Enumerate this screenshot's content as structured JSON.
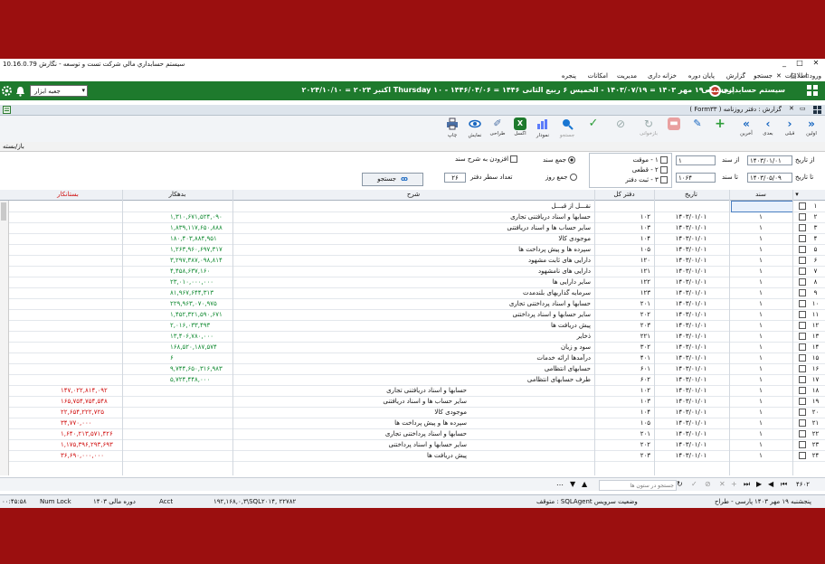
{
  "window": {
    "title": "سیستم حسابداري مالي شرکت تست و توسعه - نگارش 10.16.0.79",
    "minimize": "_",
    "maximize": "□",
    "close": "✕"
  },
  "menu": {
    "items": [
      "ورود اطلاعات",
      "جستجو",
      "گزارش",
      "پایان دوره",
      "خزانه داری",
      "مدیریت",
      "امکانات",
      "پنجره"
    ],
    "window_controls": [
      "✕",
      "□",
      "▫"
    ]
  },
  "header": {
    "system_name": "سیستم حسابداری مالی",
    "date_line": "پنجشنبه ۱۹ مهر ۱۴۰۳ = ۱۴۰۳/۰۷/۱۹ - الخمیس ۶ ربیع الثانی ۱۴۴۶ = ۱۴۴۶/۰۴/۰۶ - Thursday ۱۰ اکتبر ۲۰۲۴ = ۲۰۲۴/۱۰/۱۰",
    "toolbox_label": "جعبه ابزار"
  },
  "form": {
    "caption": "گزارش : دفتر روزنامه ( Form۳۳ )"
  },
  "toolbar": {
    "buttons": [
      {
        "label": "اولین",
        "name": "first-button"
      },
      {
        "label": "قبلی",
        "name": "prev-button"
      },
      {
        "label": "بعدی",
        "name": "next-button"
      },
      {
        "label": "آخرین",
        "name": "last-button"
      },
      {
        "label": "",
        "name": "add-button"
      },
      {
        "label": "",
        "name": "edit-button"
      },
      {
        "label": "",
        "name": "delete-button"
      },
      {
        "label": "بازخوانی",
        "name": "refresh-button"
      },
      {
        "label": "",
        "name": "cancel-button"
      },
      {
        "label": "",
        "name": "confirm-button"
      },
      {
        "label": "جستجو",
        "name": "search-button"
      },
      {
        "label": "نمودار",
        "name": "chart-button"
      },
      {
        "label": "اکسل",
        "name": "excel-button"
      },
      {
        "label": "طراحی",
        "name": "design-button"
      },
      {
        "label": "نمایش",
        "name": "preview-button"
      },
      {
        "label": "چاپ",
        "name": "print-button"
      }
    ]
  },
  "openclose": {
    "label": "باز/بسته"
  },
  "filter": {
    "from_date_label": "از تاریخ",
    "from_date": "۱۴۰۳/۰۱/۰۱",
    "to_date_label": "تا تاریخ",
    "to_date": "۱۴۰۳/۰۵/۰۹",
    "from_doc_label": "از سند",
    "from_doc": "۱",
    "to_doc_label": "تا سند",
    "to_doc": "۱۰۶۴",
    "types": [
      "۱ - موقت",
      "۲ - قطعی",
      "۳ - ثبت دفتر"
    ],
    "sum_doc_label": "جمع سند",
    "sum_day_label": "جمع روز",
    "add_desc_label": "افزودن به شرح سند",
    "rows_label": "تعداد سطر دفتر",
    "rows_value": "۲۶",
    "search_label": "جستجو"
  },
  "grid": {
    "headers": {
      "doc": "سند",
      "date": "تاریخ",
      "ledger": "دفتر کل",
      "desc": "شرح",
      "debit": "بدهکار",
      "credit": "بستانکار"
    },
    "rows": [
      {
        "n": "۱",
        "doc": "",
        "date": "",
        "code": "",
        "desc": "نقـــل از قبـــل",
        "debit": "",
        "credit": "",
        "indent": false
      },
      {
        "n": "۲",
        "doc": "۱",
        "date": "۱۴۰۳/۰۱/۰۱",
        "code": "۱۰۲",
        "desc": "حسابها و اسناد دریافتنی تجاری",
        "debit": "۱,۳۱۰,۶۷۱,۵۲۴,۰۹۰",
        "credit": "",
        "indent": false
      },
      {
        "n": "۳",
        "doc": "۱",
        "date": "۱۴۰۳/۰۱/۰۱",
        "code": "۱۰۳",
        "desc": "سایر حساب ها و اسناد دریافتنی",
        "debit": "۱,۸۳۹,۱۱۷,۶۵۰,۸۸۸",
        "credit": "",
        "indent": false
      },
      {
        "n": "۴",
        "doc": "۱",
        "date": "۱۴۰۳/۰۱/۰۱",
        "code": "۱۰۴",
        "desc": "موجودی کالا",
        "debit": "۱۸۰,۴۰۳,۸۸۴,۹۵۱",
        "credit": "",
        "indent": false
      },
      {
        "n": "۵",
        "doc": "۱",
        "date": "۱۴۰۳/۰۱/۰۱",
        "code": "۱۰۵",
        "desc": "سپرده ها و پیش پرداخت ها",
        "debit": "۱,۲۶۳,۹۶۰,۶۹۷,۳۱۷",
        "credit": "",
        "indent": false
      },
      {
        "n": "۶",
        "doc": "۱",
        "date": "۱۴۰۳/۰۱/۰۱",
        "code": "۱۲۰",
        "desc": "دارایی های ثابت مشهود",
        "debit": "۳,۲۹۷,۳۸۷,۰۹۸,۸۱۴",
        "credit": "",
        "indent": false
      },
      {
        "n": "۷",
        "doc": "۱",
        "date": "۱۴۰۳/۰۱/۰۱",
        "code": "۱۲۱",
        "desc": "دارایی های نامشهود",
        "debit": "۴,۴۵۸,۶۳۷,۱۶۰",
        "credit": "",
        "indent": false
      },
      {
        "n": "۸",
        "doc": "۱",
        "date": "۱۴۰۳/۰۱/۰۱",
        "code": "۱۲۲",
        "desc": "سایر دارایی ها",
        "debit": "۲۳,۰۱۰,۰۰۰,۰۰۰",
        "credit": "",
        "indent": false
      },
      {
        "n": "۹",
        "doc": "۱",
        "date": "۱۴۰۳/۰۱/۰۱",
        "code": "۱۲۳",
        "desc": "سرمایه گذاریهای بلندمدت",
        "debit": "۸۱,۹۶۷,۶۴۴,۳۱۳",
        "credit": "",
        "indent": false
      },
      {
        "n": "۱۰",
        "doc": "۱",
        "date": "۱۴۰۳/۰۱/۰۱",
        "code": "۲۰۱",
        "desc": "حسابها و اسناد پرداختنی تجاری",
        "debit": "۲۲۹,۹۶۳,۰۷۰,۹۷۵",
        "credit": "",
        "indent": false
      },
      {
        "n": "۱۱",
        "doc": "۱",
        "date": "۱۴۰۳/۰۱/۰۱",
        "code": "۲۰۲",
        "desc": "سایر حسابها و اسناد پرداختنی",
        "debit": "۱,۴۵۲,۳۲۱,۵۹۰,۶۷۱",
        "credit": "",
        "indent": false
      },
      {
        "n": "۱۲",
        "doc": "۱",
        "date": "۱۴۰۳/۰۱/۰۱",
        "code": "۲۰۳",
        "desc": "پیش دریافت ها",
        "debit": "۲,۰۱۶,۰۳۳,۴۹۳",
        "credit": "",
        "indent": false
      },
      {
        "n": "۱۳",
        "doc": "۱",
        "date": "۱۴۰۳/۰۱/۰۱",
        "code": "۲۲۱",
        "desc": "ذخایر",
        "debit": "۱۳,۴۰۶,۷۸۰,۰۰۰",
        "credit": "",
        "indent": false
      },
      {
        "n": "۱۴",
        "doc": "۱",
        "date": "۱۴۰۳/۰۱/۰۱",
        "code": "۳۰۲",
        "desc": "سود و زیان",
        "debit": "۱۶۸,۵۲۰,۱۸۷,۵۷۴",
        "credit": "",
        "indent": false
      },
      {
        "n": "۱۵",
        "doc": "۱",
        "date": "۱۴۰۳/۰۱/۰۱",
        "code": "۴۰۱",
        "desc": "درآمدها ارائه خدمات",
        "debit": "۶",
        "credit": "",
        "indent": false
      },
      {
        "n": "۱۶",
        "doc": "۱",
        "date": "۱۴۰۳/۰۱/۰۱",
        "code": "۶۰۱",
        "desc": "حسابهای انتظامی",
        "debit": "۹,۷۴۴,۶۵۰,۳۱۶,۹۸۳",
        "credit": "",
        "indent": false
      },
      {
        "n": "۱۷",
        "doc": "۱",
        "date": "۱۴۰۳/۰۱/۰۱",
        "code": "۶۰۲",
        "desc": "طرف حسابهای انتظامی",
        "debit": "۵,۷۲۴,۴۴۸,۰۰۰",
        "credit": "",
        "indent": false
      },
      {
        "n": "۱۸",
        "doc": "۱",
        "date": "۱۴۰۳/۰۱/۰۱",
        "code": "۱۰۲",
        "desc": "حسابها و اسناد دریافتنی تجاری",
        "debit": "",
        "credit": "۱۴۷,۰۲۲,۸۱۴,۰۹۲",
        "indent": true
      },
      {
        "n": "۱۹",
        "doc": "۱",
        "date": "۱۴۰۳/۰۱/۰۱",
        "code": "۱۰۳",
        "desc": "سایر حساب ها و اسناد دریافتنی",
        "debit": "",
        "credit": "۱۶۵,۷۵۴,۷۵۴,۵۴۸",
        "indent": true
      },
      {
        "n": "۲۰",
        "doc": "۱",
        "date": "۱۴۰۳/۰۱/۰۱",
        "code": "۱۰۴",
        "desc": "موجودی کالا",
        "debit": "",
        "credit": "۲۲,۶۵۴,۲۲۲,۷۲۵",
        "indent": true
      },
      {
        "n": "۲۱",
        "doc": "۱",
        "date": "۱۴۰۳/۰۱/۰۱",
        "code": "۱۰۵",
        "desc": "سپرده ها و پیش پرداخت ها",
        "debit": "",
        "credit": "۳۴,۷۷۰,۰۰۰",
        "indent": true
      },
      {
        "n": "۲۲",
        "doc": "۱",
        "date": "۱۴۰۳/۰۱/۰۱",
        "code": "۲۰۱",
        "desc": "حسابها و اسناد پرداختنی تجاری",
        "debit": "",
        "credit": "۱,۶۴۰,۲۱۳,۵۷۱,۴۲۶",
        "indent": true
      },
      {
        "n": "۲۳",
        "doc": "۱",
        "date": "۱۴۰۳/۰۱/۰۱",
        "code": "۲۰۲",
        "desc": "سایر حسابها و اسناد پرداختنی",
        "debit": "",
        "credit": "۱,۱۷۵,۳۹۶,۲۹۳,۶۹۳",
        "indent": true
      },
      {
        "n": "۲۴",
        "doc": "۱",
        "date": "۱۴۰۳/۰۱/۰۱",
        "code": "۲۰۳",
        "desc": "پیش دریافت ها",
        "debit": "",
        "credit": "۳۶,۶۹۰,۰۰۰,۰۰۰",
        "indent": true
      }
    ]
  },
  "navbar": {
    "count": "۴۶۰۲",
    "search_placeholder": "جستجو در ستون ها"
  },
  "status": {
    "date": "پنجشنبه ۱۹ مهر ۱۴۰۳",
    "user": "پارسی - طراح",
    "service": "متوقف : SQLAgent وضعیت سرویس",
    "server": "۱۹۲,۱۶۸,۰,۳\\SQL۲۰۱۴, ۲۲۷۸۲",
    "db": "Acct",
    "period": "دوره مالی ۱۴۰۳",
    "numlock": "Num Lock",
    "time": "۰۰:۴۵:۵۸"
  },
  "colors": {
    "green_header": "#1e7a2d",
    "frame": "#9b0f0f",
    "credit_text": "#d01010",
    "debit_text": "#128a32"
  }
}
